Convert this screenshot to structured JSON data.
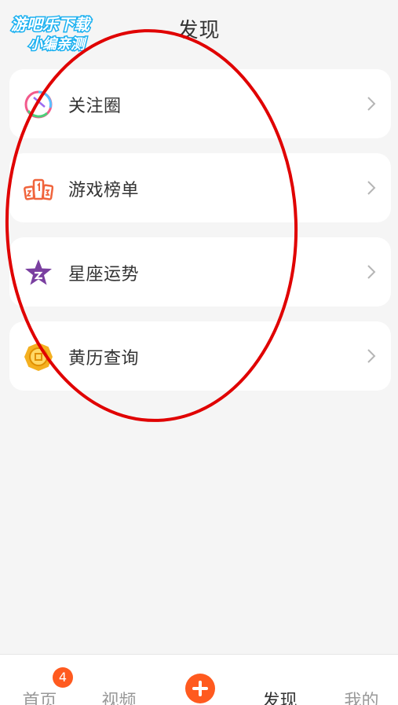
{
  "header": {
    "title": "发现",
    "watermark": {
      "line1": "游吧乐下载",
      "line2": "小编亲测"
    }
  },
  "list": {
    "items": [
      {
        "label": "关注圈",
        "icon": "follow-circle-icon"
      },
      {
        "label": "游戏榜单",
        "icon": "leaderboard-icon"
      },
      {
        "label": "星座运势",
        "icon": "star-icon"
      },
      {
        "label": "黄历查询",
        "icon": "almanac-coin-icon"
      }
    ]
  },
  "tabbar": {
    "home": {
      "label": "首页",
      "badge": "4"
    },
    "video": {
      "label": "视频"
    },
    "post": {
      "icon": "plus-icon"
    },
    "discover": {
      "label": "发现"
    },
    "mine": {
      "label": "我的"
    }
  },
  "colors": {
    "accent": "#ff5a1f",
    "annotation": "#e00000",
    "text": "#333333",
    "muted": "#999999",
    "background": "#f5f5f5"
  }
}
